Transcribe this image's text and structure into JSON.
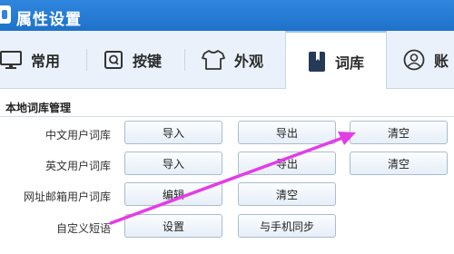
{
  "window": {
    "title": "属性设置"
  },
  "tabs": [
    {
      "label": "常用",
      "icon": "monitor-icon"
    },
    {
      "label": "按键",
      "icon": "keyboard-q-icon"
    },
    {
      "label": "外观",
      "icon": "tshirt-icon"
    },
    {
      "label": "词库",
      "icon": "book-icon",
      "active": true
    },
    {
      "label": "账",
      "icon": "user-icon"
    }
  ],
  "section": {
    "title": "本地词库管理"
  },
  "rows": [
    {
      "label": "中文用户词库",
      "buttons": [
        "导入",
        "导出",
        "清空"
      ]
    },
    {
      "label": "英文用户词库",
      "buttons": [
        "导入",
        "导出",
        "清空"
      ]
    },
    {
      "label": "网址邮箱用户词库",
      "buttons": [
        "编辑",
        "清空"
      ]
    },
    {
      "label": "自定义短语",
      "buttons": [
        "设置",
        "与手机同步"
      ]
    }
  ],
  "colors": {
    "titlebar": "#2f86de",
    "arrow": "#e23ee6",
    "accent": "#1f72c9"
  }
}
